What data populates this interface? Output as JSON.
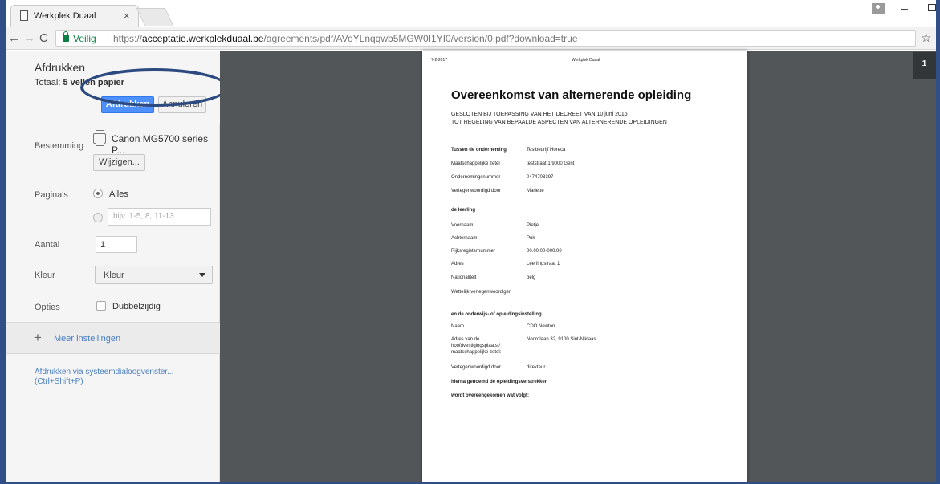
{
  "browser": {
    "tab_title": "Werkplek Duaal",
    "tab_close": "×",
    "secure_label": "Veilig",
    "url_scheme": "https://",
    "url_host": "acceptatie.werkplekduaal.be",
    "url_path": "/agreements/pdf/AVoYLnqqwb5MGW0I1YI0/version/0.pdf?download=true",
    "icons": [
      "back-icon",
      "forward-icon",
      "reload-icon",
      "lock-icon",
      "star-icon"
    ]
  },
  "print": {
    "title": "Afdrukken",
    "total_prefix": "Totaal: ",
    "total_value": "5 vellen papier",
    "print_button": "Afdrukken",
    "cancel_button": "Annuleren",
    "destination_label": "Bestemming",
    "printer_name": "Canon MG5700 series P...",
    "change_button": "Wijzigen...",
    "pages_label": "Pagina's",
    "pages_all": "Alles",
    "pages_placeholder": "bijv. 1-5, 8, 11-13",
    "copies_label": "Aantal",
    "copies_value": "1",
    "color_label": "Kleur",
    "color_value": "Kleur",
    "options_label": "Opties",
    "duplex_label": "Dubbelzijdig",
    "more_settings": "Meer instellingen",
    "system_dialog_line1": "Afdrukken via systeemdialoogvenster...",
    "system_dialog_line2": "(Ctrl+Shift+P)"
  },
  "document": {
    "date": "7-2-2017",
    "site": "Werkplek Duaal",
    "title": "Overeenkomst van alternerende opleiding",
    "subtitle1": "GESLOTEN BIJ TOEPASSING VAN HET DECREET VAN 10 juni 2016",
    "subtitle2": "TOT REGELING VAN BEPAALDE ASPECTEN VAN ALTERNERENDE OPLEIDINGEN",
    "company_heading": "Tussen de onderneming",
    "company_name": "Testbedrijf Horeca",
    "company_rows": [
      {
        "k": "Maatschappelijke zetel",
        "v": "teststraat 1 9000 Gent"
      },
      {
        "k": "Ondernemingsnummer",
        "v": "0474708397"
      },
      {
        "k": "Vertegenwoordigd door",
        "v": "Mariette"
      }
    ],
    "student_heading": "de leerling",
    "student_rows": [
      {
        "k": "Voornaam",
        "v": "Pietje"
      },
      {
        "k": "Achternaam",
        "v": "Puk"
      },
      {
        "k": "Rijksregisternummer",
        "v": "00.00.00-000.00"
      },
      {
        "k": "Adres",
        "v": "Leerlingstraat 1"
      },
      {
        "k": "Nationaliteit",
        "v": "belg"
      },
      {
        "k": "Wettelijk vertegenwoordiger",
        "v": ""
      }
    ],
    "school_heading": "en de onderwijs- of opleidingsinstelling",
    "school_rows": [
      {
        "k": "Naam",
        "v": "CDO Newton"
      },
      {
        "k": "Adres van de",
        "v": "Noordlaan 32, 9100 Sint-Niklaas"
      },
      {
        "k": "hoofdvestigingsplaats /",
        "v": ""
      },
      {
        "k": "maatschappelijke zetel:",
        "v": ""
      },
      {
        "k": "Vertegenwoordigd door",
        "v": "direkteur"
      }
    ],
    "closing1": "hierna genoemd de opleidingsverstrekker",
    "closing2": "wordt overeengekomen wat volgt:"
  },
  "preview": {
    "page_number": "1"
  },
  "colors": {
    "print_button": "#4d90fe",
    "link": "#4a7ec2",
    "secure": "#0b8043",
    "preview_bg": "#525659",
    "annotation_ellipse": "#2c4a7f"
  }
}
